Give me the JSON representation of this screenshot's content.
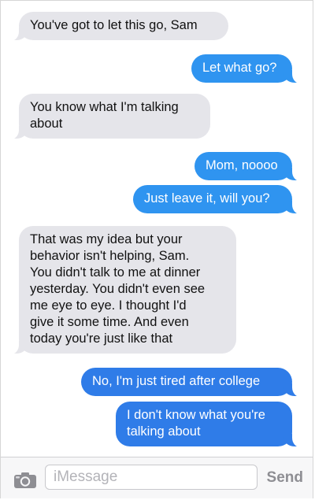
{
  "messages": [
    {
      "from": "them",
      "text": "You've got to let this go, Sam"
    },
    {
      "from": "me",
      "text": "Let what go?"
    },
    {
      "from": "them",
      "text": "You know what I'm talking\nabout"
    },
    {
      "from": "me",
      "text": "Mom, noooo"
    },
    {
      "from": "me",
      "text": "Just leave it, will you?"
    },
    {
      "from": "them",
      "text": "That was my idea but your\nbehavior isn't helping, Sam.\nYou didn't talk to me at dinner\nyesterday. You didn't even see\nme eye to eye. I thought I'd\ngive it some time. And even\ntoday you're just like that"
    },
    {
      "from": "me",
      "text": "No, I'm just tired after college"
    },
    {
      "from": "me",
      "text": "I don't know what you're\ntalking about"
    }
  ],
  "input": {
    "placeholder": "iMessage",
    "send_label": "Send",
    "camera_icon": "camera-icon"
  },
  "colors": {
    "received_bubble": "#e5e5ea",
    "sent_bubble": "#2f94f0",
    "sent_bubble_dark": "#2f7ce8",
    "send_label": "#8e8e93"
  }
}
